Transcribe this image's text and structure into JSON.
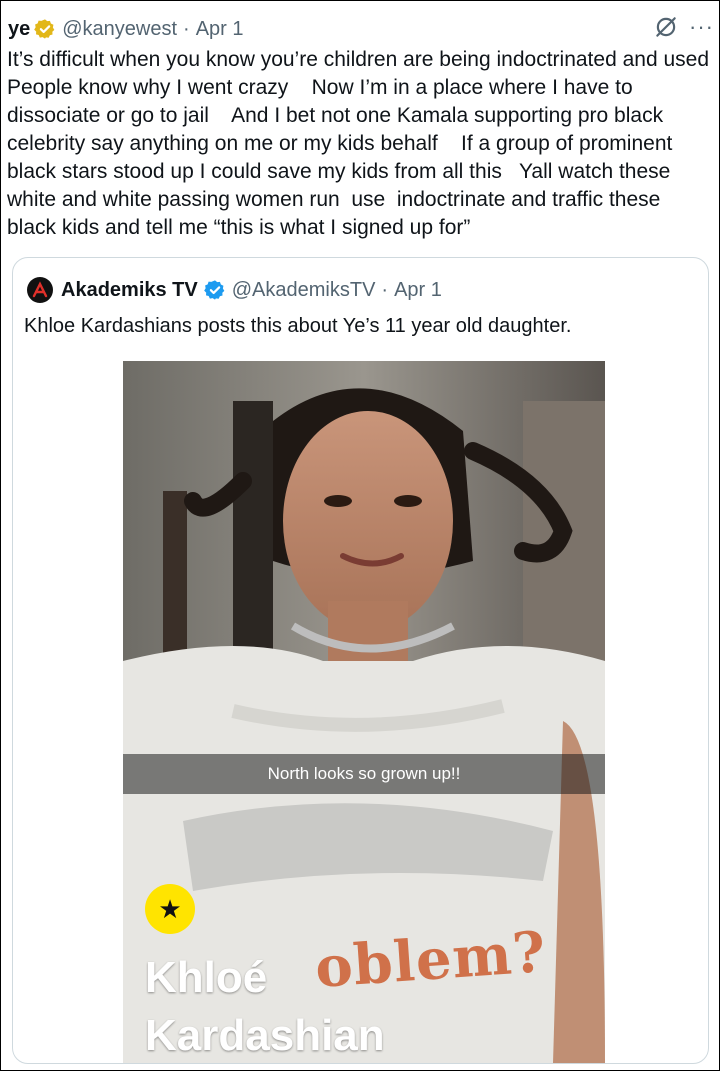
{
  "tweet": {
    "display_name": "ye",
    "handle": "@kanyewest",
    "separator": "·",
    "date": "Apr 1",
    "verified_badge_icon": "gold-verified-badge-icon",
    "more_label": "···",
    "text": "It’s difficult when you know you’re children are being indoctrinated and used    People know why I went crazy    Now I’m in a place where I have to dissociate or go to jail    And I bet not one Kamala supporting pro black celebrity say anything on me or my kids behalf    If a group of prominent black stars stood up I could save my kids from all this   Yall watch these white and white passing women run  use  indoctrinate and traffic these black kids and tell me “this is what I signed up for”"
  },
  "quote": {
    "display_name": "Akademiks TV",
    "handle": "@AkademiksTV",
    "separator": "·",
    "date": "Apr 1",
    "verified_badge_icon": "blue-verified-badge-icon",
    "text": "Khloe Kardashians posts this about Ye’s 11 year old daughter.",
    "photo": {
      "caption": "North looks so grown up!!",
      "friend_name": "Khloé\nKardashian",
      "shirt_print": "oblem?",
      "star_icon": "star-icon"
    }
  },
  "colors": {
    "text": "#0f1419",
    "secondary": "#536471",
    "border": "#cfd9de",
    "gold": "#e2b719",
    "blue": "#1d9bf0",
    "snap_yellow": "#ffe400"
  }
}
